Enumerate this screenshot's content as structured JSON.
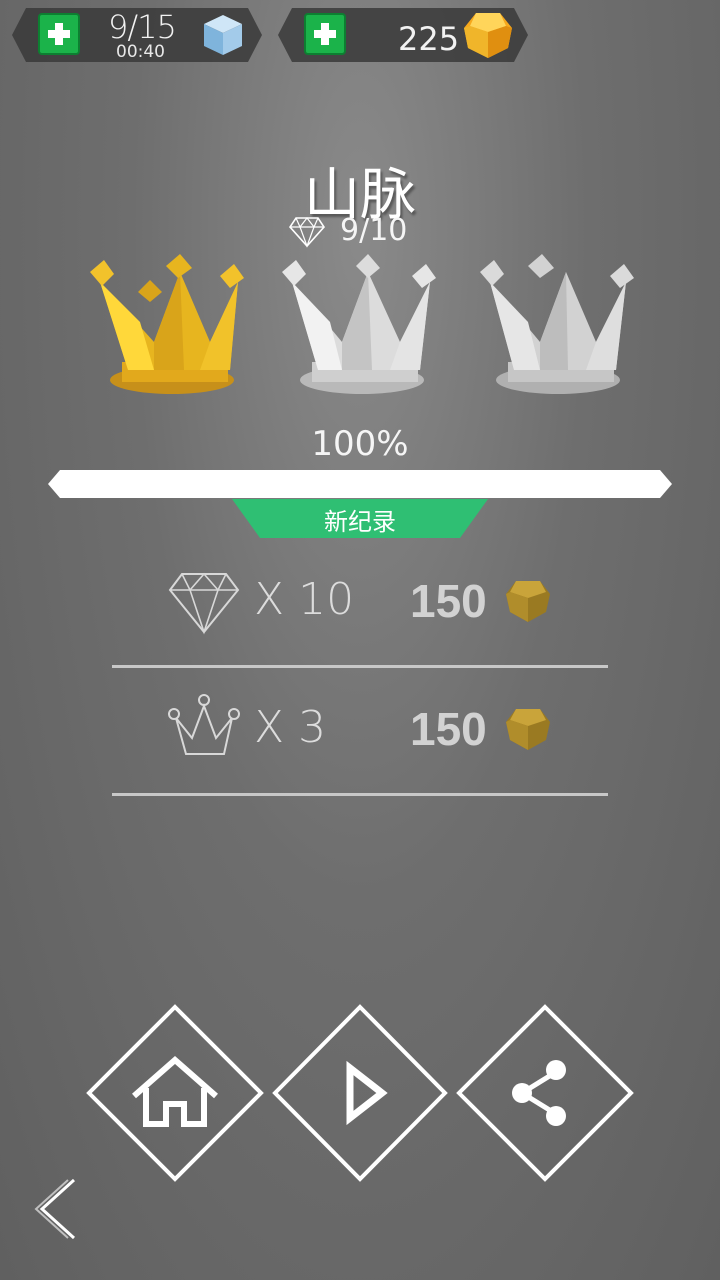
{
  "hud": {
    "energy": {
      "count": "9/15",
      "timer": "00:40",
      "icon": "blue-cube-icon",
      "add_icon": "plus-icon"
    },
    "coins": {
      "count": "225",
      "icon": "gold-gem-icon",
      "add_icon": "plus-icon"
    }
  },
  "level": {
    "title": "山脉",
    "diamonds": "9/10",
    "crowns": [
      {
        "state": "earned",
        "color": "#e6b31c"
      },
      {
        "state": "locked",
        "color": "#dadada"
      },
      {
        "state": "locked",
        "color": "#d0d0d0"
      }
    ],
    "progress_label": "100%",
    "progress": 1.0,
    "record_label": "新纪录"
  },
  "rewards": [
    {
      "icon": "diamond-outline-icon",
      "multiplier": "X 10",
      "value": "150",
      "coin_icon": "bronze-gem-icon"
    },
    {
      "icon": "crown-outline-icon",
      "multiplier": "X 3",
      "value": "150",
      "coin_icon": "bronze-gem-icon"
    }
  ],
  "buttons": [
    "home-icon",
    "play-icon",
    "share-icon"
  ],
  "back_icon": "chevron-left-icon",
  "colors": {
    "accent_green": "#2fbf73",
    "plus_green": "#1bb34a",
    "gold": "#e6b31c"
  }
}
